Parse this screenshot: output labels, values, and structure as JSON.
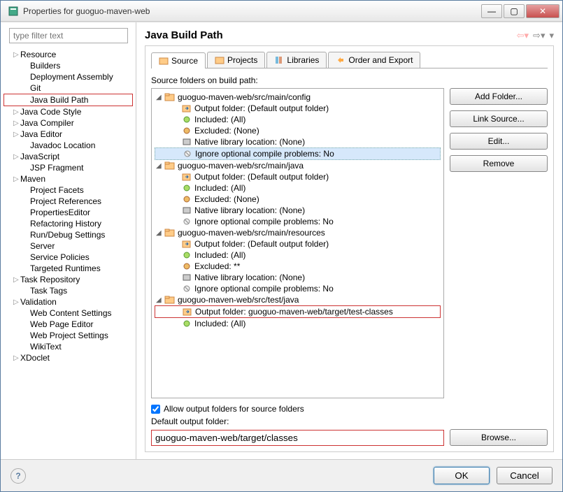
{
  "window": {
    "title": "Properties for guoguo-maven-web"
  },
  "filter": {
    "placeholder": "type filter text"
  },
  "nav_tree": {
    "items": [
      {
        "label": "Resource",
        "level": 1,
        "expandable": true
      },
      {
        "label": "Builders",
        "level": 2
      },
      {
        "label": "Deployment Assembly",
        "level": 2
      },
      {
        "label": "Git",
        "level": 2
      },
      {
        "label": "Java Build Path",
        "level": 2,
        "selected": true
      },
      {
        "label": "Java Code Style",
        "level": 1,
        "expandable": true
      },
      {
        "label": "Java Compiler",
        "level": 1,
        "expandable": true
      },
      {
        "label": "Java Editor",
        "level": 1,
        "expandable": true
      },
      {
        "label": "Javadoc Location",
        "level": 2
      },
      {
        "label": "JavaScript",
        "level": 1,
        "expandable": true
      },
      {
        "label": "JSP Fragment",
        "level": 2
      },
      {
        "label": "Maven",
        "level": 1,
        "expandable": true
      },
      {
        "label": "Project Facets",
        "level": 2
      },
      {
        "label": "Project References",
        "level": 2
      },
      {
        "label": "PropertiesEditor",
        "level": 2
      },
      {
        "label": "Refactoring History",
        "level": 2
      },
      {
        "label": "Run/Debug Settings",
        "level": 2
      },
      {
        "label": "Server",
        "level": 2
      },
      {
        "label": "Service Policies",
        "level": 2
      },
      {
        "label": "Targeted Runtimes",
        "level": 2
      },
      {
        "label": "Task Repository",
        "level": 1,
        "expandable": true
      },
      {
        "label": "Task Tags",
        "level": 2
      },
      {
        "label": "Validation",
        "level": 1,
        "expandable": true
      },
      {
        "label": "Web Content Settings",
        "level": 2
      },
      {
        "label": "Web Page Editor",
        "level": 2
      },
      {
        "label": "Web Project Settings",
        "level": 2
      },
      {
        "label": "WikiText",
        "level": 2
      },
      {
        "label": "XDoclet",
        "level": 1,
        "expandable": true
      }
    ]
  },
  "page": {
    "title": "Java Build Path"
  },
  "tabs": {
    "source": "Source",
    "projects": "Projects",
    "libraries": "Libraries",
    "order": "Order and Export"
  },
  "source": {
    "label": "Source folders on build path:",
    "folders": [
      {
        "path": "guoguo-maven-web/src/main/config",
        "output": "Output folder: (Default output folder)",
        "included": "Included: (All)",
        "excluded": "Excluded: (None)",
        "native": "Native library location: (None)",
        "ignore": "Ignore optional compile problems: No",
        "ignore_hl": true
      },
      {
        "path": "guoguo-maven-web/src/main/java",
        "output": "Output folder: (Default output folder)",
        "included": "Included: (All)",
        "excluded": "Excluded: (None)",
        "native": "Native library location: (None)",
        "ignore": "Ignore optional compile problems: No"
      },
      {
        "path": "guoguo-maven-web/src/main/resources",
        "output": "Output folder: (Default output folder)",
        "included": "Included: (All)",
        "excluded": "Excluded: **",
        "native": "Native library location: (None)",
        "ignore": "Ignore optional compile problems: No"
      },
      {
        "path": "guoguo-maven-web/src/test/java",
        "output": "Output folder: guoguo-maven-web/target/test-classes",
        "output_hl": true,
        "included": "Included: (All)"
      }
    ]
  },
  "buttons": {
    "add_folder": "Add Folder...",
    "link_source": "Link Source...",
    "edit": "Edit...",
    "remove": "Remove",
    "browse": "Browse..."
  },
  "allow_checkbox": {
    "label": "Allow output folders for source folders",
    "checked": true
  },
  "default_output": {
    "label": "Default output folder:",
    "value": "guoguo-maven-web/target/classes"
  },
  "footer": {
    "ok": "OK",
    "cancel": "Cancel"
  }
}
